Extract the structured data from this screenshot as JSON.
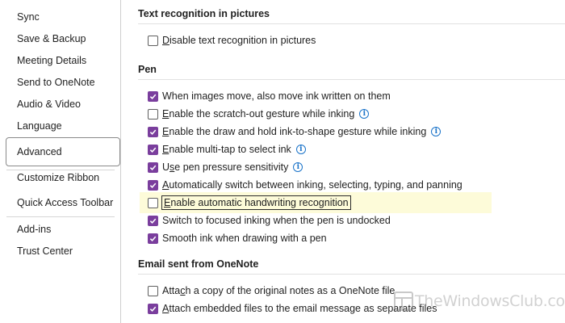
{
  "sidebar": {
    "items": [
      {
        "label": "Sync"
      },
      {
        "label": "Save & Backup"
      },
      {
        "label": "Meeting Details"
      },
      {
        "label": "Send to OneNote"
      },
      {
        "label": "Audio & Video"
      },
      {
        "label": "Language"
      },
      {
        "label": "Advanced",
        "selected": true
      },
      {
        "label": "Customize Ribbon"
      },
      {
        "label": "Quick Access Toolbar"
      },
      {
        "label": "Add-ins"
      },
      {
        "label": "Trust Center"
      }
    ]
  },
  "sections": {
    "text_recognition": {
      "title": "Text recognition in pictures",
      "options": [
        {
          "label": "Disable text recognition in pictures",
          "mnemonic": "D",
          "checked": false
        }
      ]
    },
    "pen": {
      "title": "Pen",
      "options": [
        {
          "label": "When images move, also move ink written on them",
          "checked": true
        },
        {
          "label": "Enable the scratch-out gesture while inking",
          "mnemonic": "E",
          "checked": false,
          "info_icon": true
        },
        {
          "label": "Enable the draw and hold ink-to-shape gesture while inking",
          "mnemonic": "E",
          "checked": true,
          "info_icon": true
        },
        {
          "label": "Enable multi-tap to select ink",
          "mnemonic": "E",
          "checked": true,
          "info_icon": true
        },
        {
          "label": "Use pen pressure sensitivity",
          "mnemonic": "s",
          "checked": true,
          "info_icon": true
        },
        {
          "label": "Automatically switch between inking, selecting, typing, and panning",
          "mnemonic": "A",
          "checked": true
        },
        {
          "label": "Enable automatic handwriting recognition",
          "mnemonic": "E",
          "checked": false,
          "highlighted": true
        },
        {
          "label": "Switch to focused inking when the pen is undocked",
          "checked": true
        },
        {
          "label": "Smooth ink when drawing with a pen",
          "checked": true
        }
      ]
    },
    "email": {
      "title": "Email sent from OneNote",
      "options": [
        {
          "label": "Attach a copy of the original notes as a OneNote file",
          "mnemonic": "c",
          "checked": false
        },
        {
          "label": "Attach embedded files to the email message as separate files",
          "mnemonic": "A",
          "checked": true
        }
      ]
    }
  },
  "watermark": {
    "text": "TheWindowsClub.com"
  },
  "colors": {
    "accent": "#7a3e9d",
    "info": "#1a73c9",
    "highlight": "#fdfbd9"
  }
}
